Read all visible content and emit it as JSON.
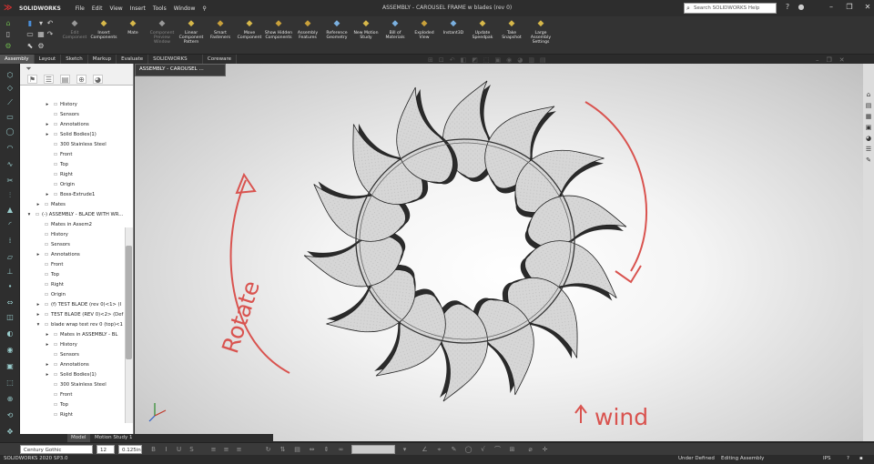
{
  "app": {
    "logo_text": "SOLIDWORKS",
    "title": "ASSEMBLY - CAROUSEL FRAME w blades (rev 0)"
  },
  "menu": [
    "File",
    "Edit",
    "View",
    "Insert",
    "Tools",
    "Window"
  ],
  "help_search": {
    "placeholder": "Search SOLIDWORKS Help"
  },
  "ribbon": {
    "tools": [
      {
        "label": "Edit Component",
        "dim": true,
        "icon": "edit-component-icon"
      },
      {
        "label": "Insert Components",
        "icon": "insert-components-icon"
      },
      {
        "label": "Mate",
        "icon": "mate-icon"
      },
      {
        "label": "Component Preview Window",
        "dim": true,
        "icon": "component-preview-icon"
      },
      {
        "label": "Linear Component Pattern",
        "icon": "linear-pattern-icon"
      },
      {
        "label": "Smart Fasteners",
        "icon": "smart-fasteners-icon"
      },
      {
        "label": "Move Component",
        "icon": "move-component-icon"
      },
      {
        "label": "Show Hidden Components",
        "icon": "show-hidden-icon"
      },
      {
        "label": "Assembly Features",
        "icon": "assembly-features-icon"
      },
      {
        "label": "Reference Geometry",
        "icon": "reference-geometry-icon"
      },
      {
        "label": "New Motion Study",
        "icon": "motion-study-icon"
      },
      {
        "label": "Bill of Materials",
        "icon": "bom-icon"
      },
      {
        "label": "Exploded View",
        "icon": "exploded-view-icon"
      },
      {
        "label": "Instant3D",
        "icon": "instant3d-icon"
      },
      {
        "label": "Update Speedpak",
        "icon": "speedpak-icon"
      },
      {
        "label": "Take Snapshot",
        "icon": "snapshot-icon"
      },
      {
        "label": "Large Assembly Settings",
        "icon": "large-assembly-icon"
      }
    ]
  },
  "tabs": [
    "Assembly",
    "Layout",
    "Sketch",
    "Markup",
    "Evaluate",
    "SOLIDWORKS Add-Ins",
    "Coreware"
  ],
  "doc_tab": "ASSEMBLY - CAROUSEL ...",
  "tree": [
    {
      "label": "History",
      "indent": 2,
      "arrow": "▸"
    },
    {
      "label": "Sensors",
      "indent": 2,
      "arrow": ""
    },
    {
      "label": "Annotations",
      "indent": 2,
      "arrow": "▸"
    },
    {
      "label": "Solid Bodies(1)",
      "indent": 2,
      "arrow": "▸"
    },
    {
      "label": "300 Stainless Steel",
      "indent": 2,
      "arrow": ""
    },
    {
      "label": "Front",
      "indent": 2,
      "arrow": ""
    },
    {
      "label": "Top",
      "indent": 2,
      "arrow": ""
    },
    {
      "label": "Right",
      "indent": 2,
      "arrow": ""
    },
    {
      "label": "Origin",
      "indent": 2,
      "arrow": ""
    },
    {
      "label": "Boss-Extrude1",
      "indent": 2,
      "arrow": "▸"
    },
    {
      "label": "Mates",
      "indent": 1,
      "arrow": "▸"
    },
    {
      "label": "(-) ASSEMBLY - BLADE WITH WR...",
      "indent": 0,
      "arrow": "▾"
    },
    {
      "label": "Mates in Assem2",
      "indent": 1,
      "arrow": ""
    },
    {
      "label": "History",
      "indent": 1,
      "arrow": ""
    },
    {
      "label": "Sensors",
      "indent": 1,
      "arrow": ""
    },
    {
      "label": "Annotations",
      "indent": 1,
      "arrow": "▸"
    },
    {
      "label": "Front",
      "indent": 1,
      "arrow": ""
    },
    {
      "label": "Top",
      "indent": 1,
      "arrow": ""
    },
    {
      "label": "Right",
      "indent": 1,
      "arrow": ""
    },
    {
      "label": "Origin",
      "indent": 1,
      "arrow": ""
    },
    {
      "label": "(f) TEST BLADE (rev 0)<1> (I",
      "indent": 1,
      "arrow": "▸"
    },
    {
      "label": "TEST BLADE (REV 0)<2> (Def",
      "indent": 1,
      "arrow": "▸"
    },
    {
      "label": "blade wrap test rev 0 (top)<1",
      "indent": 1,
      "arrow": "▾"
    },
    {
      "label": "Mates in ASSEMBLY - BL",
      "indent": 2,
      "arrow": "▸"
    },
    {
      "label": "History",
      "indent": 2,
      "arrow": "▸"
    },
    {
      "label": "Sensors",
      "indent": 2,
      "arrow": ""
    },
    {
      "label": "Annotations",
      "indent": 2,
      "arrow": "▸"
    },
    {
      "label": "Solid Bodies(1)",
      "indent": 2,
      "arrow": "▸"
    },
    {
      "label": "300 Stainless Steel",
      "indent": 2,
      "arrow": ""
    },
    {
      "label": "Front",
      "indent": 2,
      "arrow": ""
    },
    {
      "label": "Top",
      "indent": 2,
      "arrow": ""
    },
    {
      "label": "Right",
      "indent": 2,
      "arrow": ""
    }
  ],
  "annotations": {
    "rotate": "Rotate",
    "wind": "wind"
  },
  "bottom_tabs": {
    "model": "Model",
    "motion": "Motion Study 1"
  },
  "format_bar": {
    "font": "Century Gothic",
    "size": "12",
    "height": "0.125in"
  },
  "status": {
    "version": "SOLIDWORKS 2020 SP3.0",
    "state1": "Under Defined",
    "state2": "Editing Assembly",
    "units": "IPS"
  }
}
